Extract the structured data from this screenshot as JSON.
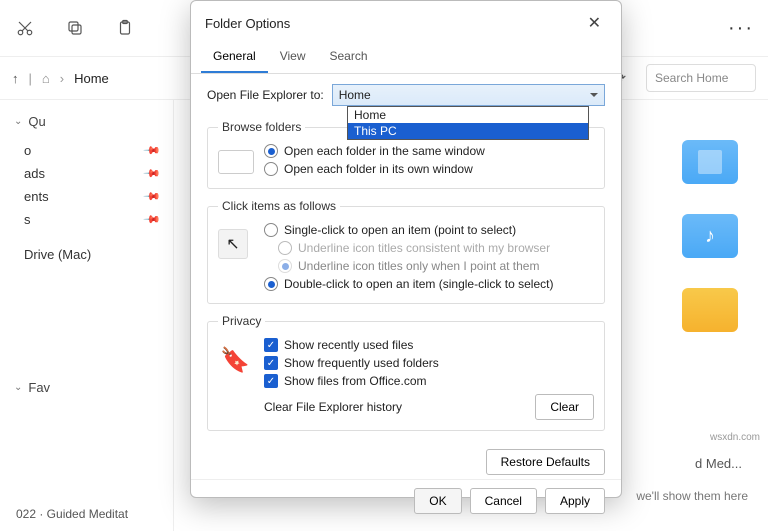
{
  "explorer": {
    "breadcrumb": "Home",
    "search_placeholder": "Search Home",
    "sidebar": {
      "quick": "Qu",
      "items": [
        "o",
        "ads",
        "ents",
        "s"
      ],
      "drive": "Drive (Mac)",
      "fav": "Fav"
    },
    "content_label": "d Med...",
    "hint": "we'll show them here",
    "status": "022 · Guided Meditat"
  },
  "dialog": {
    "title": "Folder Options",
    "tabs": {
      "general": "General",
      "view": "View",
      "search": "Search"
    },
    "open_label": "Open File Explorer to:",
    "combo_value": "Home",
    "dropdown": [
      "Home",
      "This PC"
    ],
    "browse": {
      "legend": "Browse folders",
      "same": "Open each folder in the same window",
      "own": "Open each folder in its own window"
    },
    "click": {
      "legend": "Click items as follows",
      "single": "Single-click to open an item (point to select)",
      "ul_browser": "Underline icon titles consistent with my browser",
      "ul_point": "Underline icon titles only when I point at them",
      "double": "Double-click to open an item (single-click to select)"
    },
    "privacy": {
      "legend": "Privacy",
      "recent": "Show recently used files",
      "freq": "Show frequently used folders",
      "office": "Show files from Office.com",
      "clear_label": "Clear File Explorer history",
      "clear_btn": "Clear"
    },
    "restore": "Restore Defaults",
    "ok": "OK",
    "cancel": "Cancel",
    "apply": "Apply"
  },
  "watermark": "wsxdn.com"
}
